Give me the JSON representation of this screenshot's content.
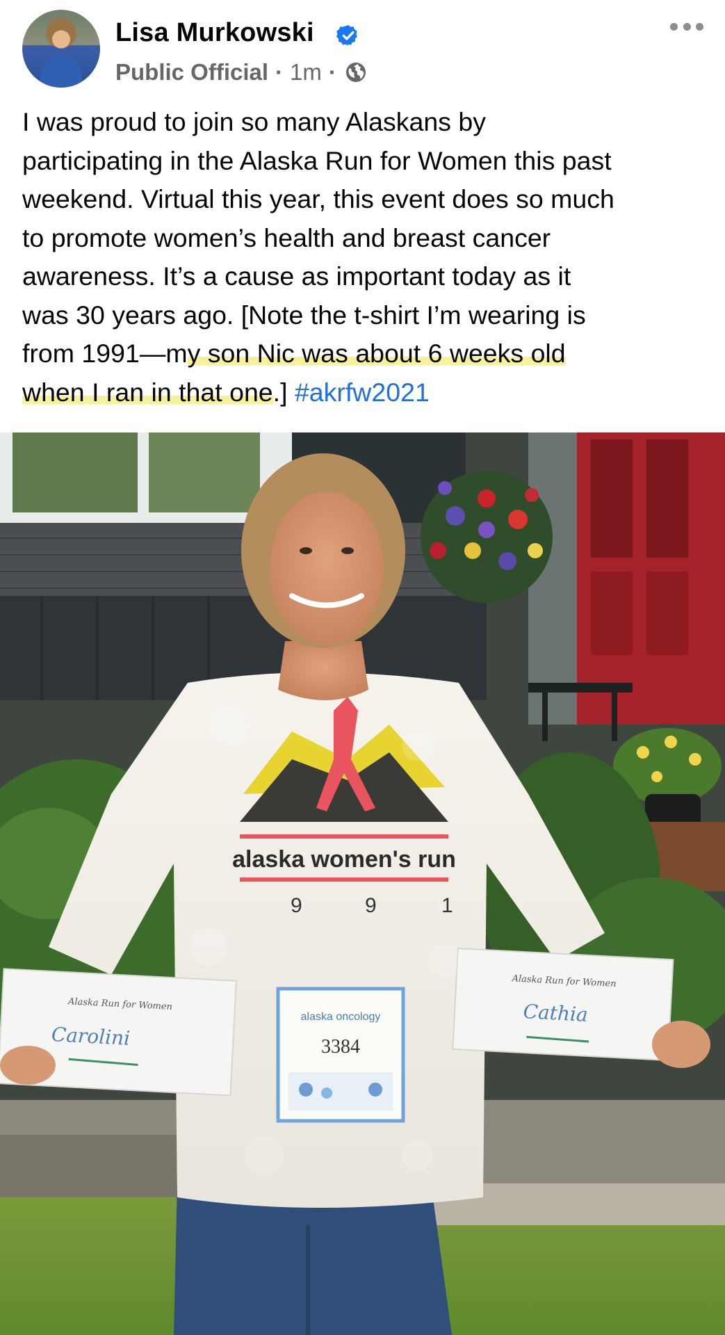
{
  "post": {
    "author": "Lisa Murkowski",
    "category": "Public Official",
    "time": "1m",
    "text_lines": [
      "I was proud to join so many Alaskans by",
      "participating in the Alaska Run for Women this past",
      "weekend. Virtual this year, this event does so much",
      "to promote women’s health and breast cancer",
      "awareness. It’s a cause as important today as it",
      "was 30 years ago. [Note the t-shirt I’m wearing is"
    ],
    "line7_plain": "from 1991—m",
    "line7_highlight": "y son Nic was about 6 weeks old",
    "line8_highlight": "when I ran in that one",
    "line8_plain": ".] ",
    "hashtag": "#akrfw2021"
  },
  "photo": {
    "shirt_text": "alaska women's run",
    "shirt_year_digits": [
      "9",
      "9",
      "1"
    ],
    "bib_sponsor": "alaska oncology",
    "bib_number": "3384",
    "card_left_name": "Carolini",
    "card_right_name": "Cathia",
    "card_header": "Alaska Run for Women"
  },
  "colors": {
    "verified": "#1877f2",
    "hashtag": "#216fdb",
    "highlight": "#f2ee78",
    "meta": "#65676b"
  },
  "icons": {
    "verified": "verified-badge-icon",
    "audience": "globe-icon",
    "menu": "more-options-icon"
  }
}
